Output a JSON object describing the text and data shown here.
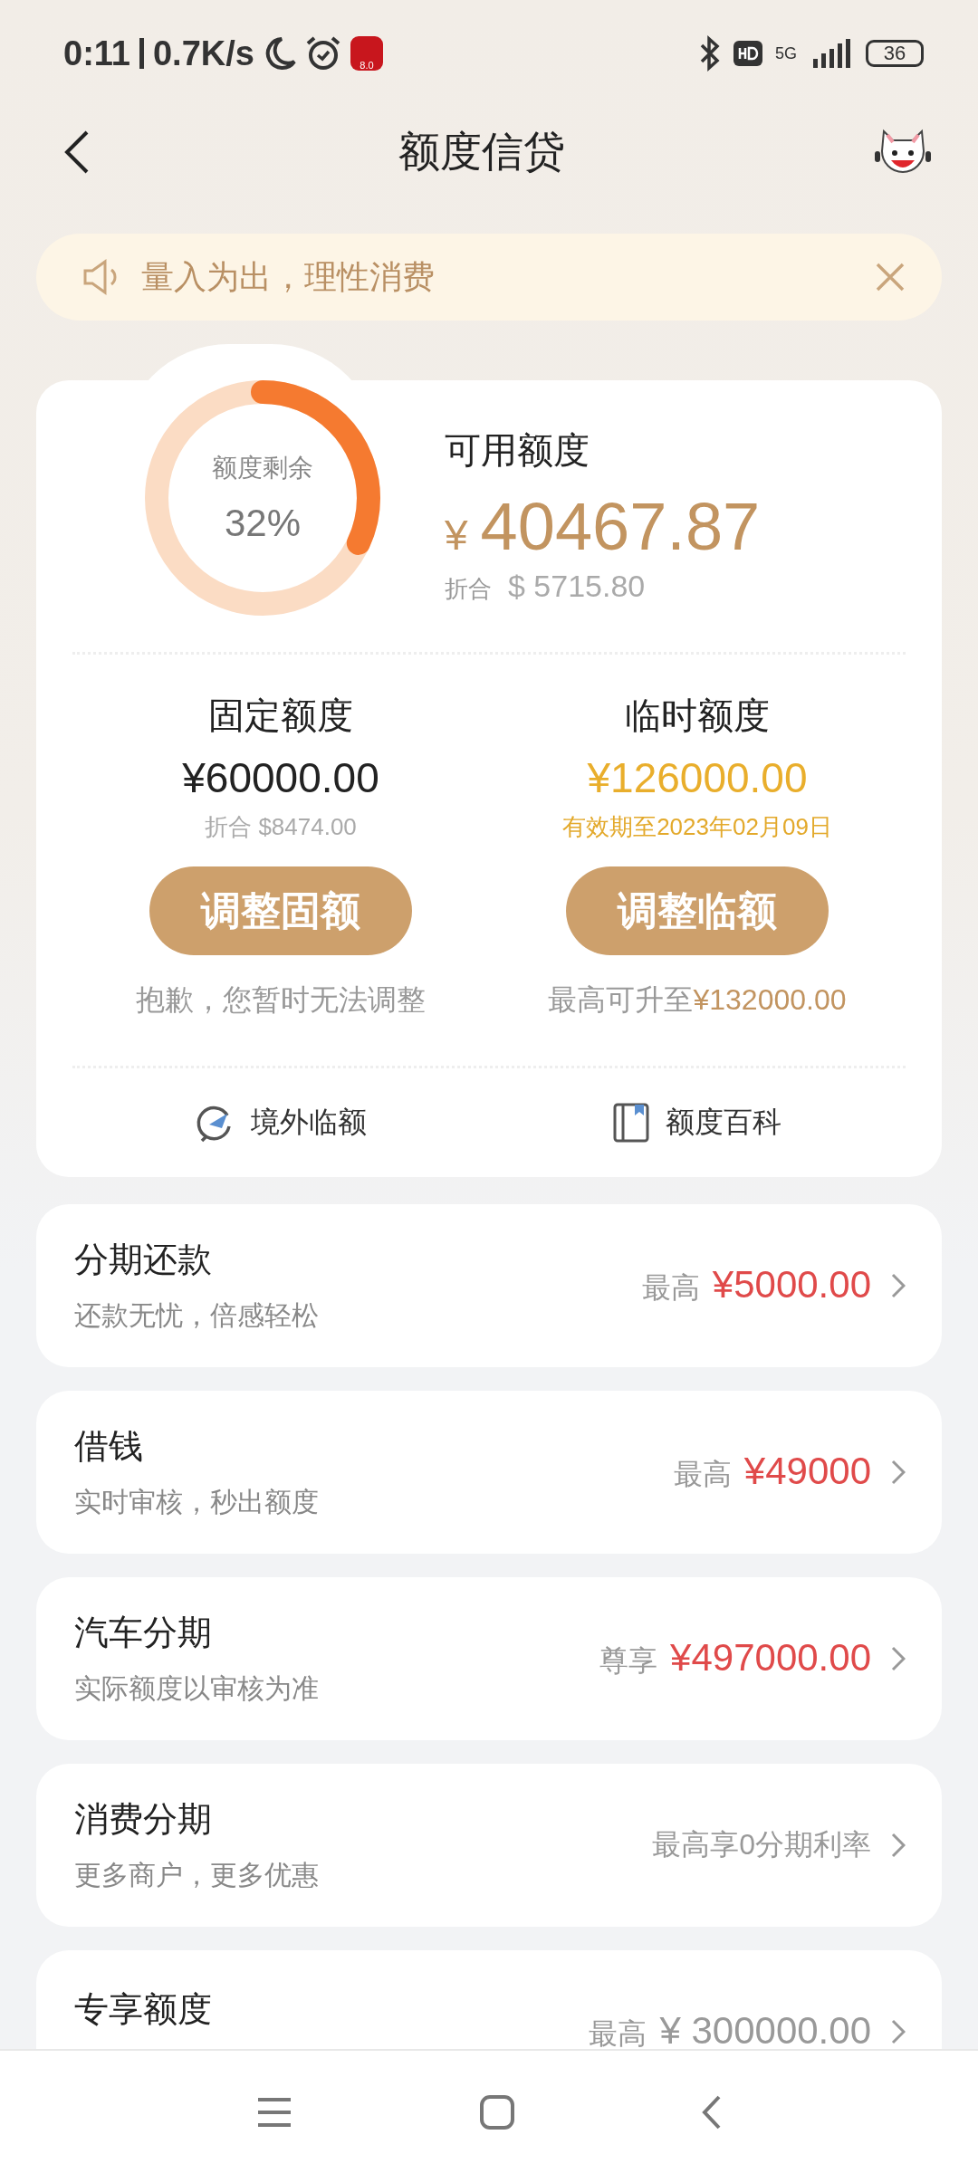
{
  "status_bar": {
    "time": "0:11",
    "speed": "0.7K/s",
    "app_badge": "8.0",
    "network": "5G",
    "battery": "36"
  },
  "header": {
    "title": "额度信贷"
  },
  "notice": {
    "text": "量入为出，理性消费"
  },
  "credit": {
    "ring": {
      "label": "额度剩余",
      "percent": "32%"
    },
    "available_label": "可用额度",
    "currency": "¥",
    "available": "40467.87",
    "converted_label": "折合",
    "converted": "$ 5715.80",
    "columns": [
      {
        "title": "固定额度",
        "amount": "¥60000.00",
        "note": "折合 $8474.00",
        "highlight": false,
        "button": "调整固额",
        "hint": "抱歉，您暂时无法调整"
      },
      {
        "title": "临时额度",
        "amount": "¥126000.00",
        "note": "有效期至2023年02月09日",
        "highlight": true,
        "button": "调整临额",
        "hint": "最高可升至",
        "hint_amount": "¥132000.00"
      }
    ],
    "links": [
      {
        "label": "境外临额",
        "kind": "plane"
      },
      {
        "label": "额度百科",
        "kind": "book"
      }
    ]
  },
  "products": [
    {
      "title": "分期还款",
      "subtitle": "还款无忧，倍感轻松",
      "label": "最高",
      "amount": "¥5000.00",
      "highlight": true
    },
    {
      "title": "借钱",
      "subtitle": "实时审核，秒出额度",
      "label": "最高",
      "amount": "¥49000",
      "highlight": true
    },
    {
      "title": "汽车分期",
      "subtitle": "实际额度以审核为准",
      "label": "尊享",
      "amount": "¥497000.00",
      "highlight": true
    },
    {
      "title": "消费分期",
      "subtitle": "更多商户，更多优惠",
      "label": "最高享0分期利率"
    },
    {
      "title": "专享额度",
      "label": "最高",
      "amount": "¥ 300000.00",
      "highlight": false
    }
  ]
}
